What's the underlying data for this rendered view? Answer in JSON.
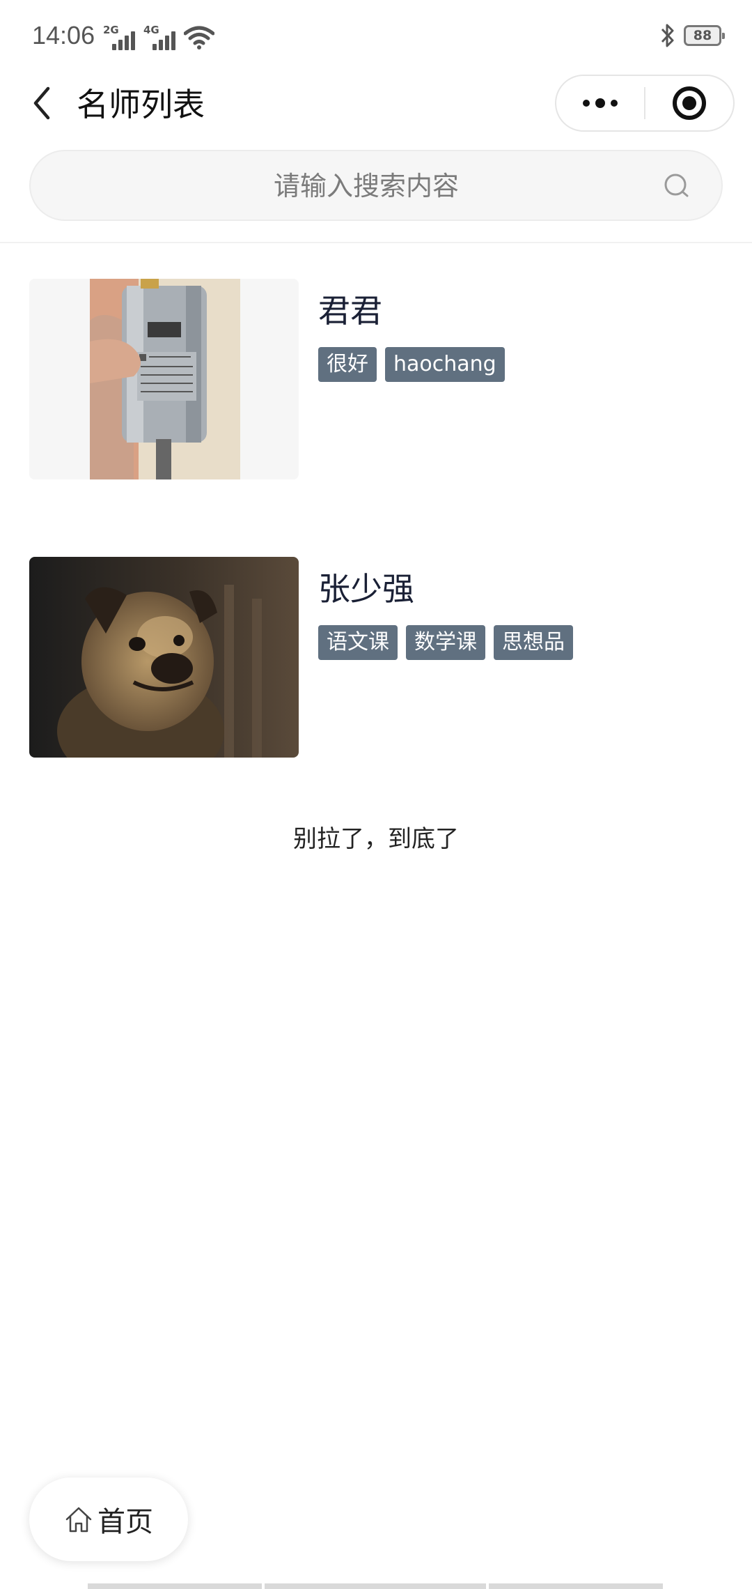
{
  "status_bar": {
    "time": "14:06",
    "networks": [
      "2G",
      "4G"
    ],
    "battery_level": "88"
  },
  "nav": {
    "title": "名师列表"
  },
  "search": {
    "placeholder": "请输入搜索内容"
  },
  "teachers": [
    {
      "name": "君君",
      "tags": [
        "很好",
        "haochang"
      ],
      "image": "photo of a silver electric motor held in hand"
    },
    {
      "name": "张少强",
      "tags": [
        "语文课",
        "数学课",
        "思想品"
      ],
      "image": "photo of a pug dog"
    }
  ],
  "list_end_text": "别拉了，到底了",
  "home_button": {
    "label": "首页"
  },
  "colors": {
    "tag_background": "#607080",
    "title_text": "#1a2035",
    "search_background": "#f6f6f6"
  },
  "icons": {
    "back": "chevron-left-icon",
    "more": "more-dots-icon",
    "close": "target-circle-icon",
    "search": "search-icon",
    "home": "home-icon",
    "bluetooth": "bluetooth-icon",
    "wifi": "wifi-icon"
  }
}
